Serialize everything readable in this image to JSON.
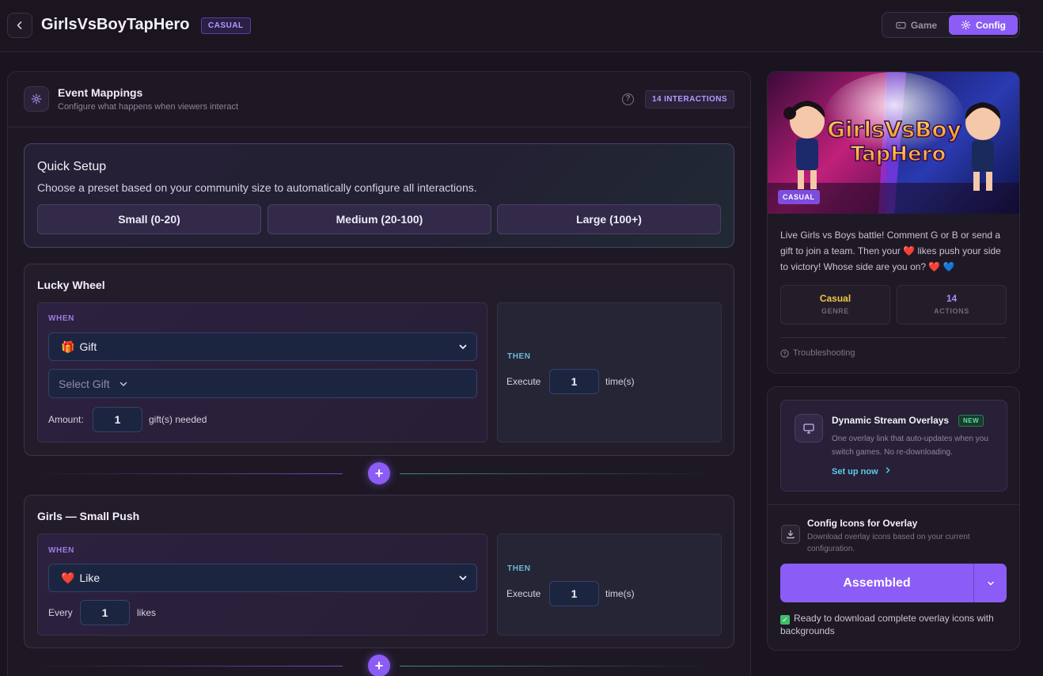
{
  "header": {
    "title": "GirlsVsBoyTapHero",
    "genre_tag": "CASUAL",
    "mode_game": "Game",
    "mode_config": "Config"
  },
  "mappings": {
    "title": "Event Mappings",
    "subtitle": "Configure what happens when viewers interact",
    "count_badge": "14 INTERACTIONS"
  },
  "quick_setup": {
    "title": "Quick Setup",
    "description": "Choose a preset based on your community size to automatically configure all interactions.",
    "presets": [
      "Small (0-20)",
      "Medium (20-100)",
      "Large (100+)"
    ]
  },
  "cards": [
    {
      "title": "Lucky Wheel",
      "when_label": "WHEN",
      "event": "Gift",
      "event_emoji": "🎁",
      "gift_select": "Select Gift",
      "amount_label": "Amount:",
      "amount_value": "1",
      "amount_suffix": "gift(s) needed",
      "then_label": "THEN",
      "execute_label": "Execute",
      "execute_value": "1",
      "execute_suffix": "time(s)"
    },
    {
      "title": "Girls — Small Push",
      "when_label": "WHEN",
      "event": "Like",
      "event_emoji": "❤️",
      "every_label": "Every",
      "every_value": "1",
      "every_suffix": "likes",
      "then_label": "THEN",
      "execute_label": "Execute",
      "execute_value": "1",
      "execute_suffix": "time(s)"
    }
  ],
  "game_info": {
    "hero_title_line1": "GirlsVsBoy",
    "hero_title_line2": "TapHero",
    "badge": "CASUAL",
    "description": "Live Girls vs Boys battle! Comment G or B or send a gift to join a team. Then your ❤️ likes push your side to victory! Whose side are you on? ❤️ 💙",
    "genre_value": "Casual",
    "genre_label": "GENRE",
    "actions_value": "14",
    "actions_label": "ACTIONS",
    "troubleshooting": "Troubleshooting"
  },
  "overlay": {
    "title": "Dynamic Stream Overlays",
    "new_badge": "NEW",
    "description": "One overlay link that auto-updates when you switch games. No re-downloading.",
    "link": "Set up now",
    "config_icons_title": "Config Icons for Overlay",
    "config_icons_desc": "Download overlay icons based on your current configuration.",
    "assembled_button": "Assembled",
    "ready_text": "Ready to download complete overlay icons with backgrounds"
  },
  "colors": {
    "accent": "#8b5cf6",
    "genre": "#f5c542",
    "actions": "#a78bfa",
    "link": "#5fc8ea"
  }
}
